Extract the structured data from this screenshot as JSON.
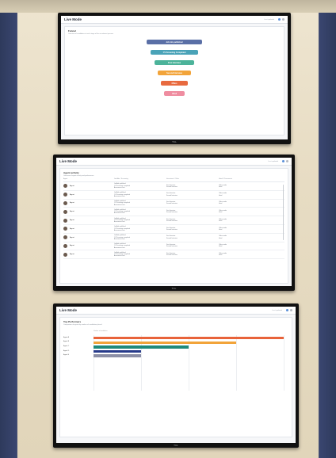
{
  "screens": [
    {
      "app_title": "Live Mode",
      "meta": "Last updated",
      "card_title": "Funnel",
      "card_sub": "Overview of candidates at each stage of the recruitment process",
      "funnel": [
        {
          "label": "Job Ads published",
          "value": "",
          "color": "#5a6fa6"
        },
        {
          "label": "CV Screening Completed",
          "value": "",
          "color": "#4aa3b8"
        },
        {
          "label": "First Interview",
          "value": "",
          "color": "#4cb39a"
        },
        {
          "label": "Second Interview",
          "value": "",
          "color": "#f2a43a"
        },
        {
          "label": "Offers",
          "value": "",
          "color": "#e86a3f"
        },
        {
          "label": "Hired",
          "value": "",
          "color": "#ef8da0"
        }
      ]
    },
    {
      "app_title": "Live Mode",
      "meta": "Last updated",
      "card_title": "Agent activity",
      "card_sub": "Overview of agent activity and performance",
      "headers": [
        "Agent",
        "Job Ads / Screening",
        "Interviews / Offers",
        "Hired / Placements"
      ],
      "rows": [
        {
          "name": "Agent"
        },
        {
          "name": "Agent"
        },
        {
          "name": "Agent"
        },
        {
          "name": "Agent"
        },
        {
          "name": "Agent"
        },
        {
          "name": "Agent"
        },
        {
          "name": "Agent"
        },
        {
          "name": "Agent"
        },
        {
          "name": "Agent"
        }
      ],
      "cell_text": {
        "a1": "Job Ads published",
        "a2": "CV Screening completed",
        "a3": "Assessment sent",
        "b1": "First Interview",
        "b2": "Second Interview",
        "c1": "Offers made",
        "c2": "Hired"
      }
    },
    {
      "app_title": "Live Mode",
      "meta": "Last updated",
      "card_title": "Top Performers",
      "card_sub": "Comparison of agents by number of candidates placed",
      "axis_label": "Number of candidates",
      "chart_data": {
        "type": "bar",
        "orientation": "horizontal",
        "categories": [
          "Agent A",
          "Agent B",
          "Agent C",
          "Agent D",
          "Agent E"
        ],
        "series": [
          {
            "values": [
              100,
              75,
              50,
              25,
              25
            ]
          }
        ],
        "colors": [
          "#e8633a",
          "#f2a43a",
          "#1e8a7a",
          "#273a8a",
          "#8c8fa6"
        ],
        "xlim": [
          0,
          100
        ]
      }
    }
  ]
}
